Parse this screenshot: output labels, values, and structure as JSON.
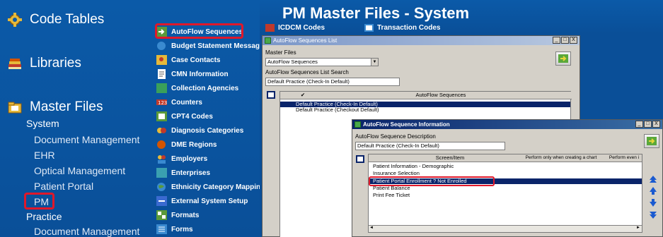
{
  "nav": {
    "items": [
      {
        "label": "Code Tables",
        "icon": "gear-icon"
      },
      {
        "label": "Libraries",
        "icon": "books-icon"
      },
      {
        "label": "Master Files",
        "icon": "folder-icon"
      }
    ],
    "sub_items": [
      "System",
      "Document Management",
      "EHR",
      "Optical Management",
      "Patient Portal",
      "PM",
      "Practice",
      "Document Management"
    ]
  },
  "menu": {
    "items": [
      "AutoFlow Sequences",
      "Budget Statement Messages",
      "Case Contacts",
      "CMN Information",
      "Collection Agencies",
      "Counters",
      "CPT4 Codes",
      "Diagnosis Categories",
      "DME Regions",
      "Employers",
      "Enterprises",
      "Ethnicity Category Mapping",
      "External System Setup",
      "Formats",
      "Forms"
    ]
  },
  "header": {
    "title": "PM Master Files - System",
    "tabs": [
      "ICDCM Codes",
      "Transaction Codes"
    ]
  },
  "list_window": {
    "title": "AutoFlow Sequences List",
    "master_files_label": "Master Files",
    "master_files_value": "AutoFlow Sequences",
    "search_label": "AutoFlow Sequences List Search",
    "search_value": "Default Practice (Check-In Default)",
    "column_header": "AutoFlow Sequences",
    "rows": [
      "Default Practice (Check-In Default)",
      "Default Practice (Checkout Default)"
    ],
    "buttons": [
      "_",
      "□",
      "X"
    ]
  },
  "info_window": {
    "title": "AutoFlow Sequence Information",
    "desc_label": "AutoFlow Sequence Description",
    "desc_value": "Default Practice (Check-In Default)",
    "columns": [
      "Screen/Item",
      "Perform only when creating a chart",
      "Perform even i"
    ],
    "rows": [
      "Patient Information - Demographic",
      "Insurance Selection",
      "Patient Portal Enrollment ? Not Enrolled",
      "Patient Balance",
      "Print Fee Ticket"
    ],
    "buttons": [
      "_",
      "□",
      "X"
    ]
  },
  "colors": {
    "nav_bg": "#0b5aa8",
    "highlight_border": "#e0182a",
    "selected_row": "#0a246a",
    "titlebar": "#0a246a"
  }
}
